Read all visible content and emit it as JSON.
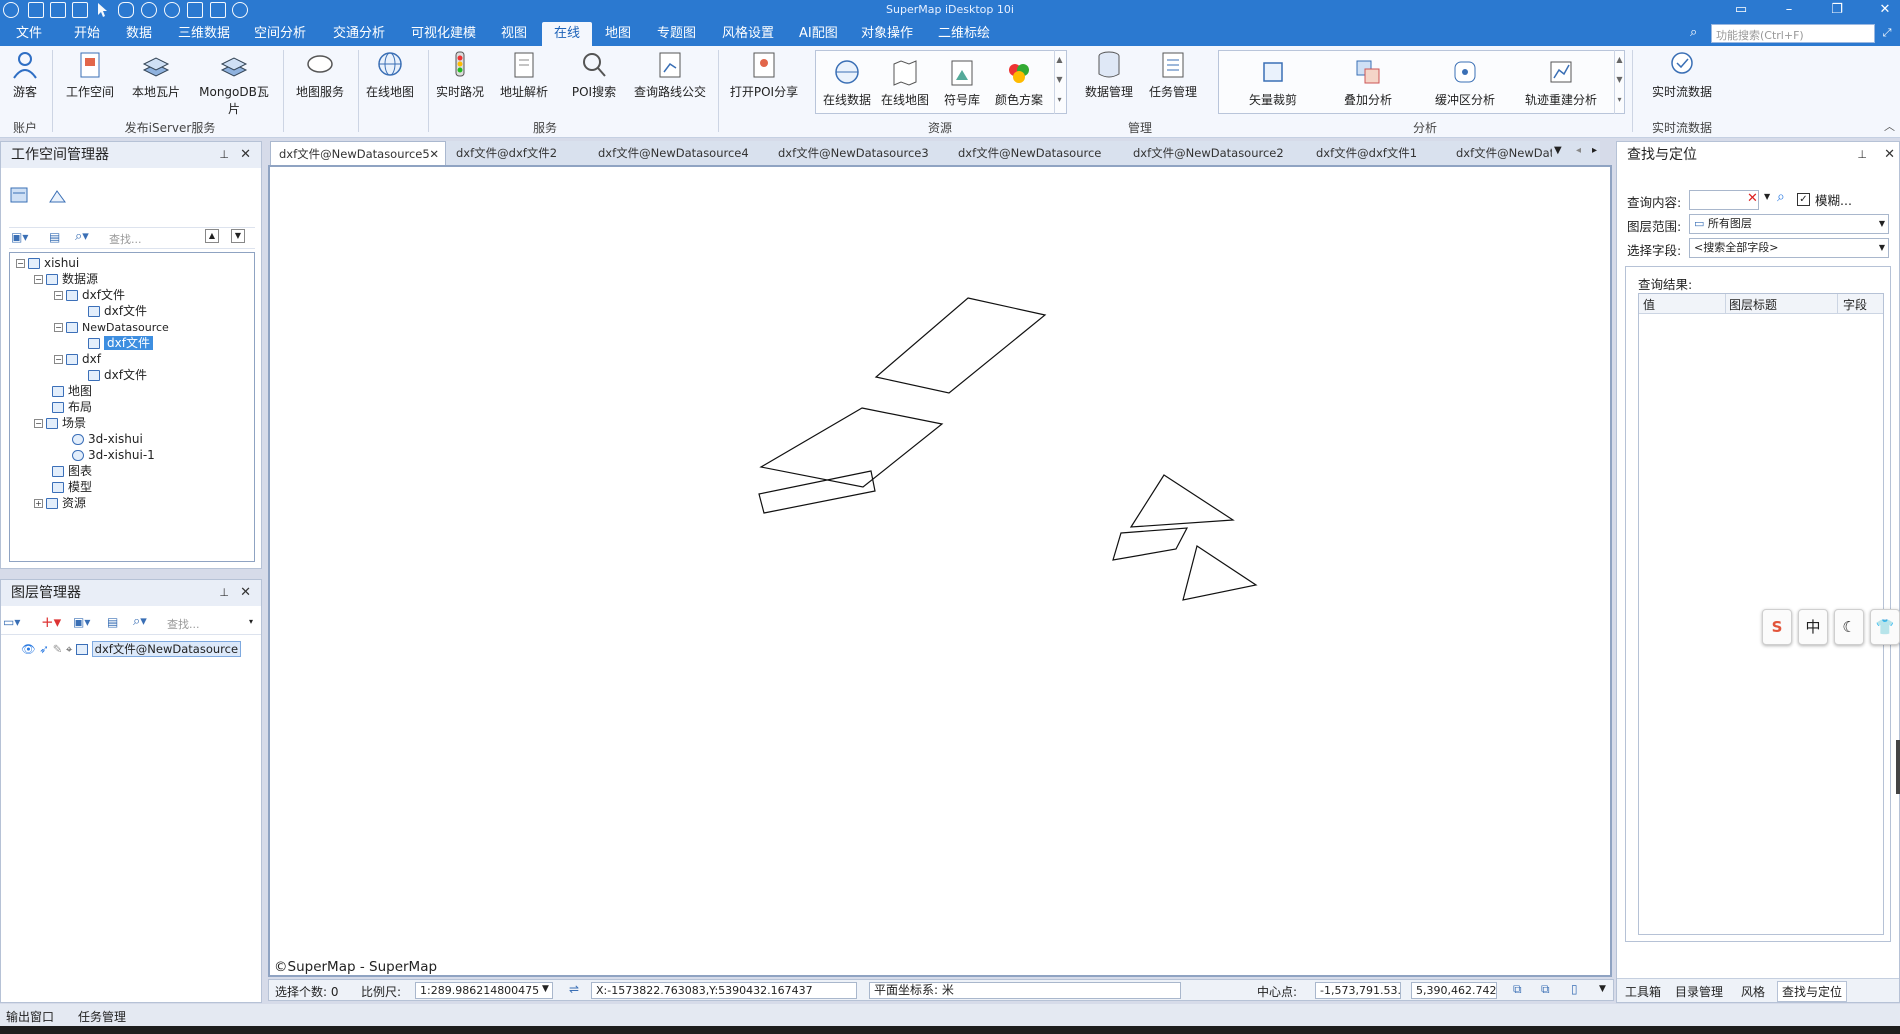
{
  "app": {
    "title": "SuperMap iDesktop 10i"
  },
  "menu": {
    "items": [
      "文件",
      "开始",
      "数据",
      "三维数据",
      "空间分析",
      "交通分析",
      "可视化建模",
      "视图",
      "在线",
      "地图",
      "专题图",
      "风格设置",
      "AI配图",
      "对象操作",
      "二维标绘"
    ],
    "active": "在线",
    "search_placeholder": "功能搜索(Ctrl+F)"
  },
  "ribbon": {
    "buttons": {
      "guest": "游客",
      "workspace": "工作空间",
      "local_tiles": "本地瓦片",
      "mongodb_tiles": "MongoDB瓦片",
      "map_service": "地图服务",
      "online_map": "在线地图",
      "realtime_traffic": "实时路况",
      "address_parse": "地址解析",
      "poi_search": "POI搜索",
      "route_query": "查询路线公交",
      "open_poi_share": "打开POI分享",
      "online_data": "在线数据",
      "online_map2": "在线地图",
      "symbol_lib": "符号库",
      "color_scheme": "颜色方案",
      "data_manage": "数据管理",
      "task_manage": "任务管理",
      "vector_clip": "矢量裁剪",
      "overlay": "叠加分析",
      "buffer": "缓冲区分析",
      "trajectory": "轨迹重建分析",
      "realtime_stream": "实时流数据"
    },
    "groups": {
      "account": "账户",
      "publish": "发布iServer服务",
      "service": "服务",
      "resource": "资源",
      "manage": "管理",
      "analysis": "分析",
      "stream": "实时流数据"
    }
  },
  "workspace_panel": {
    "title": "工作空间管理器",
    "search_placeholder": "查找...",
    "tree": {
      "root": "xishui",
      "datasources": "数据源",
      "ds1": "dxf文件",
      "ds1_child": "dxf文件",
      "ds2": "NewDatasource",
      "ds2_child": "dxf文件",
      "ds3": "dxf",
      "ds3_child": "dxf文件",
      "maps": "地图",
      "layouts": "布局",
      "scenes": "场景",
      "scene1": "3d-xishui",
      "scene2": "3d-xishui-1",
      "charts": "图表",
      "models": "模型",
      "resources": "资源"
    }
  },
  "layer_panel": {
    "title": "图层管理器",
    "search_placeholder": "查找...",
    "layer": "dxf文件@NewDatasource"
  },
  "doc_tabs": {
    "items": [
      "dxf文件@NewDatasource5",
      "dxf文件@dxf文件2",
      "dxf文件@NewDatasource4",
      "dxf文件@NewDatasource3",
      "dxf文件@NewDatasource",
      "dxf文件@NewDatasource2",
      "dxf文件@dxf文件1",
      "dxf文件@NewData"
    ],
    "active_index": 0
  },
  "map": {
    "copyright": "©SuperMap - SuperMap"
  },
  "status": {
    "selected_count": "选择个数: 0",
    "scale_label": "比例尺:",
    "scale_value": "1:289.986214800475",
    "coords": "X:-1573822.763083,Y:5390432.167437",
    "crs": "平面坐标系: 米",
    "center_label": "中心点:",
    "center_x": "-1,573,791.53...",
    "center_y": "5,390,462.742..."
  },
  "find_panel": {
    "title": "查找与定位",
    "query_label": "查询内容:",
    "fuzzy_label": "模糊...",
    "layer_scope_label": "图层范围:",
    "layer_scope_value": "所有图层",
    "field_label": "选择字段:",
    "field_value": "<搜索全部字段>",
    "results_label": "查询结果:",
    "columns": [
      "值",
      "图层标题",
      "字段"
    ]
  },
  "right_tabs": [
    "工具箱",
    "目录管理",
    "风格",
    "查找与定位"
  ],
  "bottom_tabs": [
    "输出窗口",
    "任务管理"
  ],
  "ime": [
    "中"
  ]
}
